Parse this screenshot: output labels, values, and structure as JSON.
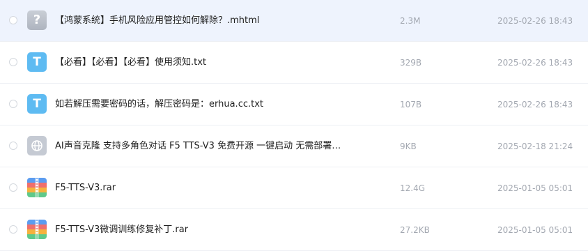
{
  "files": [
    {
      "name": "【鸿蒙系统】手机风险应用管控如何解除？.mhtml",
      "size": "2.3M",
      "modified": "2025-02-26 18:43",
      "icon": "unknown-file-icon",
      "icon_glyph": "?",
      "selected": true
    },
    {
      "name": "【必看】【必看】【必看】使用须知.txt",
      "size": "329B",
      "modified": "2025-02-26 18:43",
      "icon": "text-file-icon",
      "icon_glyph": "T",
      "selected": false
    },
    {
      "name": "如若解压需要密码的话，解压密码是：erhua.cc.txt",
      "size": "107B",
      "modified": "2025-02-26 18:43",
      "icon": "text-file-icon",
      "icon_glyph": "T",
      "selected": false
    },
    {
      "name": "AI声音克隆 支持多角色对话 F5 TTS-V3 免费开源 一键启动 无需部署…",
      "size": "9KB",
      "modified": "2025-02-18 21:24",
      "icon": "globe-link-icon",
      "selected": false
    },
    {
      "name": "F5-TTS-V3.rar",
      "size": "12.4G",
      "modified": "2025-01-05 05:01",
      "icon": "archive-icon",
      "selected": false
    },
    {
      "name": "F5-TTS-V3微调训练修复补丁.rar",
      "size": "27.2KB",
      "modified": "2025-01-05 05:01",
      "icon": "archive-icon",
      "selected": false
    }
  ],
  "colors": {
    "selected_row": "#eef3fd",
    "text_icon": "#5ebbf2",
    "meta_text": "#a3a8b1",
    "archive_blue": "#5b9cf0",
    "archive_red": "#ef6f6c",
    "archive_orange": "#f6b23d",
    "archive_green": "#5fc98a"
  }
}
